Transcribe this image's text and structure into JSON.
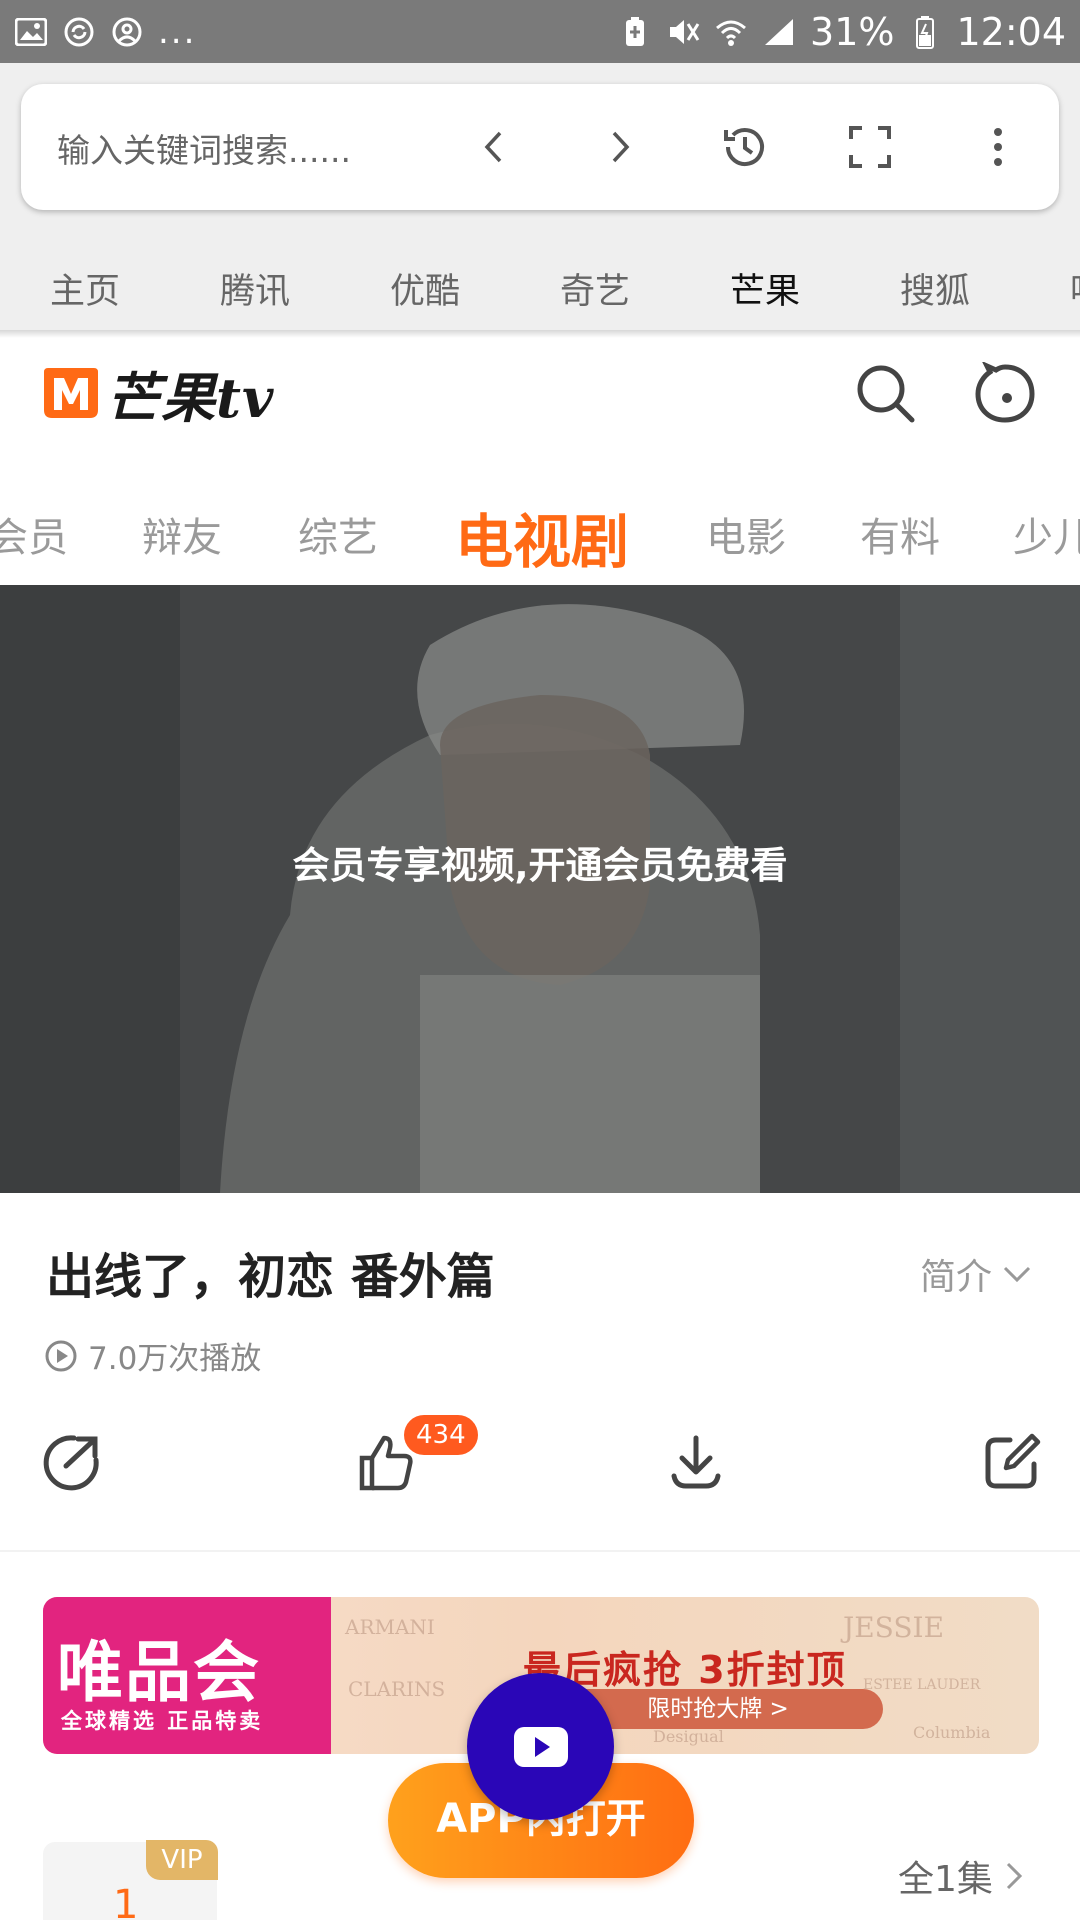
{
  "status_bar": {
    "notification_more": "...",
    "battery": "31%",
    "time": "12:04",
    "icons": [
      "image-icon",
      "sync-icon",
      "account-icon",
      "battery-saver-icon",
      "mute-icon",
      "wifi-icon",
      "signal-icon",
      "battery-icon"
    ]
  },
  "browser": {
    "search_placeholder": "输入关键词搜索......",
    "toolbar_icons": [
      "back-icon",
      "forward-icon",
      "history-icon",
      "fullscreen-icon",
      "more-icon"
    ],
    "site_tabs": [
      {
        "label": "主页"
      },
      {
        "label": "腾讯"
      },
      {
        "label": "优酷"
      },
      {
        "label": "奇艺"
      },
      {
        "label": "芒果",
        "active": true
      },
      {
        "label": "搜狐"
      },
      {
        "label": "咪"
      }
    ]
  },
  "header": {
    "logo_text": "芒果tv",
    "brand_color": "#ff6a15",
    "icons": [
      "search-icon",
      "user-icon"
    ]
  },
  "categories": [
    {
      "label": "会员"
    },
    {
      "label": "辩友"
    },
    {
      "label": "综艺"
    },
    {
      "label": "电视剧",
      "active": true
    },
    {
      "label": "电影"
    },
    {
      "label": "有料"
    },
    {
      "label": "少儿"
    }
  ],
  "video": {
    "overlay_message": "会员专享视频,开通会员免费看"
  },
  "info": {
    "title": "出线了，初恋 番外篇",
    "intro_label": "简介",
    "play_count": "7.0万次播放",
    "actions": [
      "share-icon",
      "like-icon",
      "download-icon",
      "comment-icon"
    ],
    "like_count": "434"
  },
  "ad": {
    "brand": "唯品会",
    "brand_sub": "全球精选  正品特卖",
    "headline": "最后疯抢  3折封顶",
    "cta": "限时抢大牌 >",
    "brand_logos": [
      "ARMANI",
      "CLARINS",
      "JESSIE",
      "ESTEE LAUDER",
      "Columbia",
      "Desigual"
    ]
  },
  "floating": {
    "app_open_label": "APP内打开",
    "accent": "#2a06b7"
  },
  "episodes": {
    "badge": "VIP",
    "first_number": "1",
    "all_label": "全1集"
  }
}
